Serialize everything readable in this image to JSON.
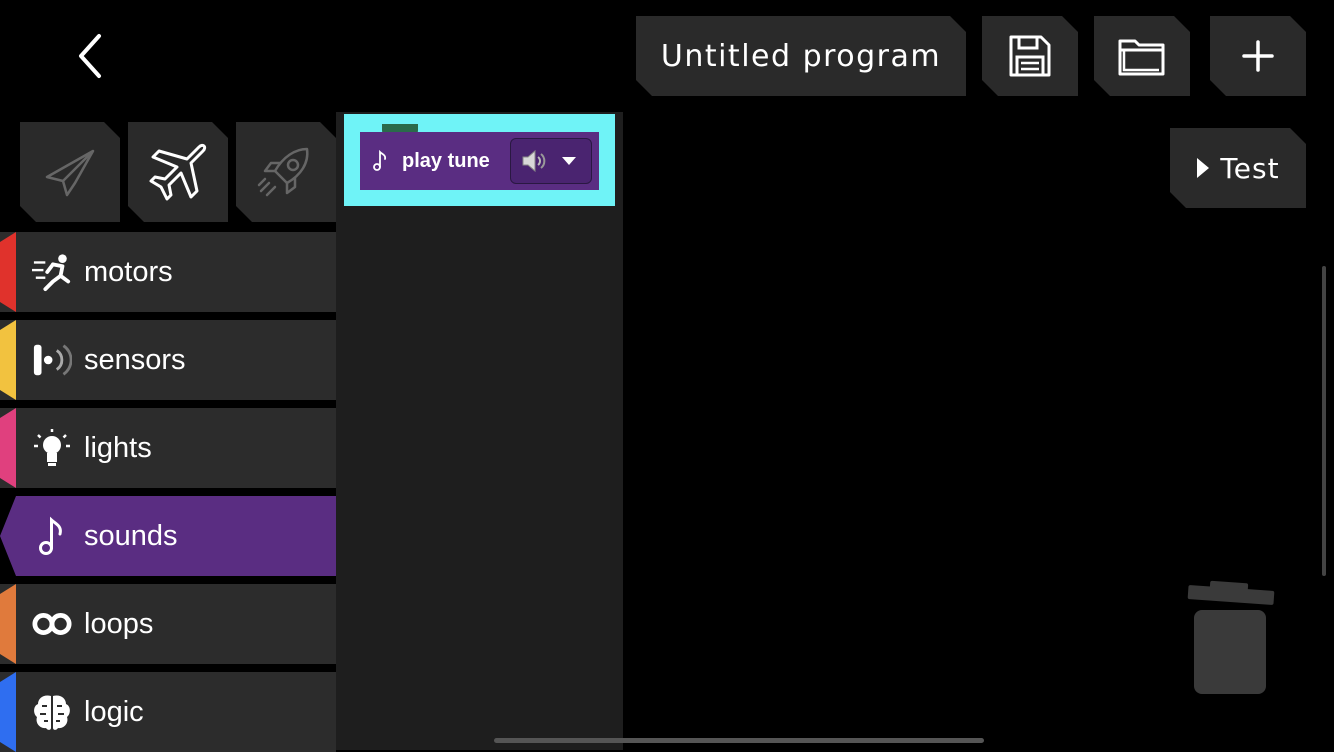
{
  "header": {
    "program_title": "Untitled program",
    "test_label": "Test"
  },
  "icons": {
    "back": "chevron-left-icon",
    "save": "floppy-disk-icon",
    "open": "folder-icon",
    "new": "plus-icon",
    "test": "play-triangle-icon"
  },
  "vehicles": [
    {
      "name": "paper-plane",
      "active": false
    },
    {
      "name": "airplane",
      "active": true
    },
    {
      "name": "rocket",
      "active": false
    }
  ],
  "categories": [
    {
      "label": "motors",
      "color": "#e0322c",
      "icon": "running-figure-icon"
    },
    {
      "label": "sensors",
      "color": "#f2c23f",
      "icon": "sensor-wave-icon"
    },
    {
      "label": "lights",
      "color": "#e0407e",
      "icon": "light-bulb-icon"
    },
    {
      "label": "sounds",
      "color": "#5a2d82",
      "icon": "music-note-icon",
      "active": true
    },
    {
      "label": "loops",
      "color": "#e07a3c",
      "icon": "infinity-loop-icon"
    },
    {
      "label": "logic",
      "color": "#2f6ef0",
      "icon": "brain-icon"
    }
  ],
  "flyout": {
    "block_label": "play tune",
    "block_color": "#5a2d82",
    "highlight_color": "#6ff3f7"
  }
}
